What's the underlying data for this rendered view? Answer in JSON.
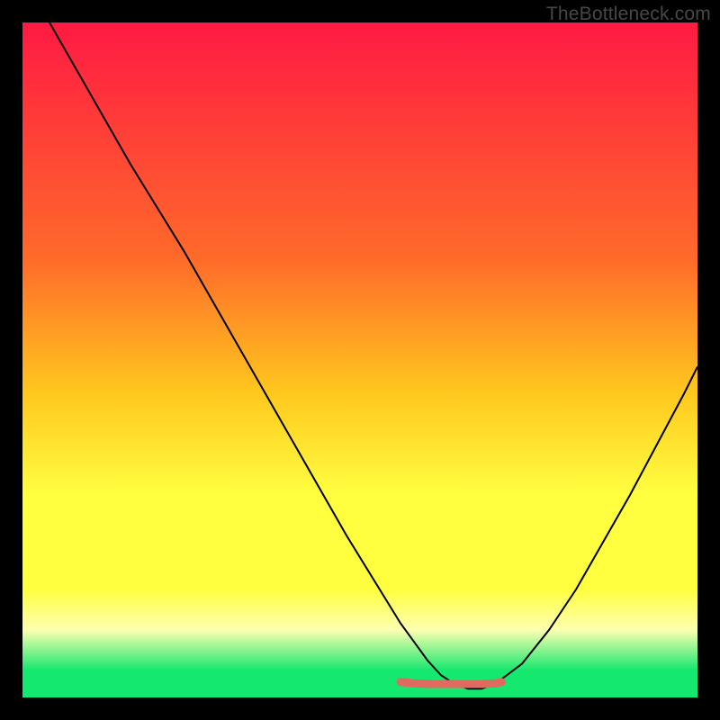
{
  "watermark": "TheBottleneck.com",
  "colors": {
    "page_bg": "#000000",
    "wm_text": "#474747",
    "grad_top": "#ff1a43",
    "grad_mid1": "#ff6a2a",
    "grad_mid2": "#ffc81e",
    "grad_mid3": "#ffff40",
    "grad_pale": "#fcffb0",
    "grad_bottom": "#15e86e",
    "curve": "#000000",
    "accent": "#e06a5f"
  },
  "chart_data": {
    "type": "line",
    "title": "",
    "xlabel": "",
    "ylabel": "",
    "xlim": [
      0,
      100
    ],
    "ylim": [
      0,
      100
    ],
    "grid": false,
    "legend": false,
    "series": [
      {
        "name": "bottleneck-curve",
        "x": [
          4,
          8,
          12,
          16,
          20,
          24,
          28,
          32,
          36,
          40,
          44,
          48,
          52,
          56,
          60,
          62,
          64,
          66,
          68,
          70,
          74,
          78,
          82,
          86,
          90,
          94,
          98,
          100
        ],
        "y": [
          100,
          93,
          86,
          79,
          72.5,
          66,
          59,
          52,
          45,
          38,
          31,
          24,
          17.5,
          11,
          5.5,
          3.3,
          2,
          1.3,
          1.3,
          2,
          5,
          10,
          16,
          23,
          30,
          37.5,
          45,
          49
        ]
      }
    ],
    "accent_segment": {
      "name": "optimal-range",
      "x": [
        56,
        58,
        60,
        62,
        64,
        66,
        68,
        70,
        71
      ],
      "y": [
        2.3,
        2.1,
        2.0,
        2.0,
        2.0,
        2.0,
        2.0,
        2.1,
        2.3
      ]
    },
    "gradient_stops_pct": [
      0,
      35,
      55,
      70,
      84,
      90,
      96,
      100
    ]
  }
}
